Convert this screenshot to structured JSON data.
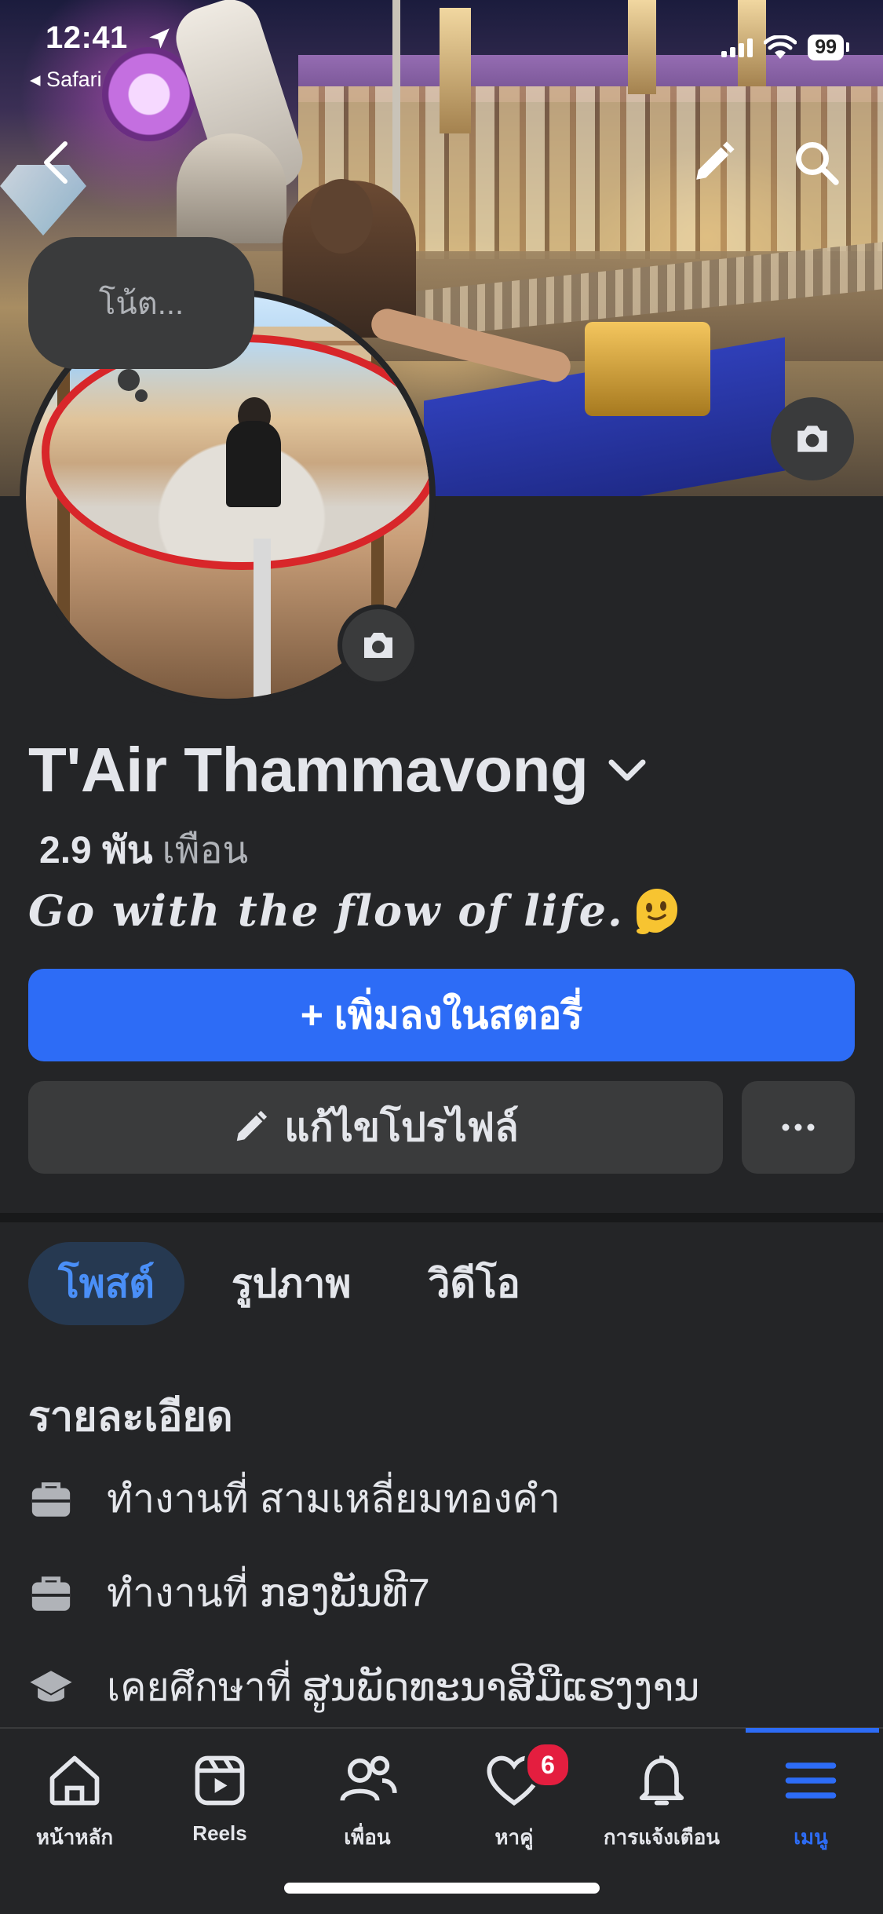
{
  "status_bar": {
    "time": "12:41",
    "back_app": "◂ Safari",
    "battery": "99"
  },
  "note": {
    "placeholder": "โน้ต..."
  },
  "profile": {
    "name": "T'Air Thammavong",
    "friends_count": "2.9 พัน",
    "friends_label": "เพือน",
    "bio": "Go with the flow of life."
  },
  "actions": {
    "add_story": "+ เพิ่มลงในสตอรี่",
    "edit_profile": "แก้ไขโปรไฟล์",
    "more": "···"
  },
  "tabs": [
    {
      "label": "โพสต์",
      "active": true
    },
    {
      "label": "รูปภาพ",
      "active": false
    },
    {
      "label": "วิดีโอ",
      "active": false
    }
  ],
  "details": {
    "title": "รายละเอียด",
    "items": [
      {
        "icon": "briefcase-icon",
        "prefix": "ทำงานที่",
        "value": "สามเหลี่ยมทองคำ"
      },
      {
        "icon": "briefcase-icon",
        "prefix": "ทำงานที่",
        "value": "ກອງພັນທີ7"
      },
      {
        "icon": "graduation-cap-icon",
        "prefix": "เคยศึกษาที่",
        "value": "ສູນພັດທະນາສີມືແຮງງານ"
      }
    ]
  },
  "bottom_nav": [
    {
      "label": "หน้าหลัก",
      "icon": "home-icon",
      "active": false
    },
    {
      "label": "Reels",
      "icon": "reels-icon",
      "active": false
    },
    {
      "label": "เพื่อน",
      "icon": "friends-icon",
      "active": false
    },
    {
      "label": "หาคู่",
      "icon": "dating-heart-icon",
      "active": false,
      "badge": "6"
    },
    {
      "label": "การแจ้งเตือน",
      "icon": "bell-icon",
      "active": false
    },
    {
      "label": "เมนู",
      "icon": "menu-icon",
      "active": true
    }
  ],
  "colors": {
    "background": "#242527",
    "primary": "#2d6cf6",
    "surface": "#3a3b3c",
    "active_tab_bg": "#263951",
    "active_tab_text": "#4a8ff7",
    "badge": "#e41e3f"
  }
}
